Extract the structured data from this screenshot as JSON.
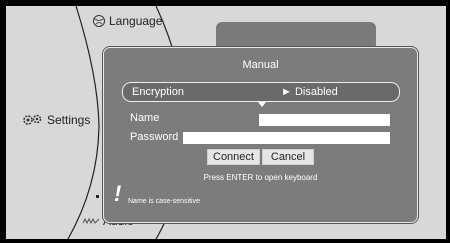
{
  "menu": {
    "language_label": "Language",
    "settings_label": "Settings",
    "audio_label": "Audio"
  },
  "dialog": {
    "title": "Manual",
    "encryption_label": "Encryption",
    "encryption_value": "► Disabled",
    "name_label": "Name",
    "name_value": "",
    "password_label": "Password",
    "password_value": "",
    "connect_label": "Connect",
    "cancel_label": "Cancel",
    "hint": "Press ENTER  to open keyboard",
    "warning_icon": "!",
    "note": "Name is case-sensitive"
  },
  "colors": {
    "panel_bg": "#d8d8d8",
    "dialog_bg": "#7c7c7c",
    "dialog_border": "#e8e8e8"
  }
}
